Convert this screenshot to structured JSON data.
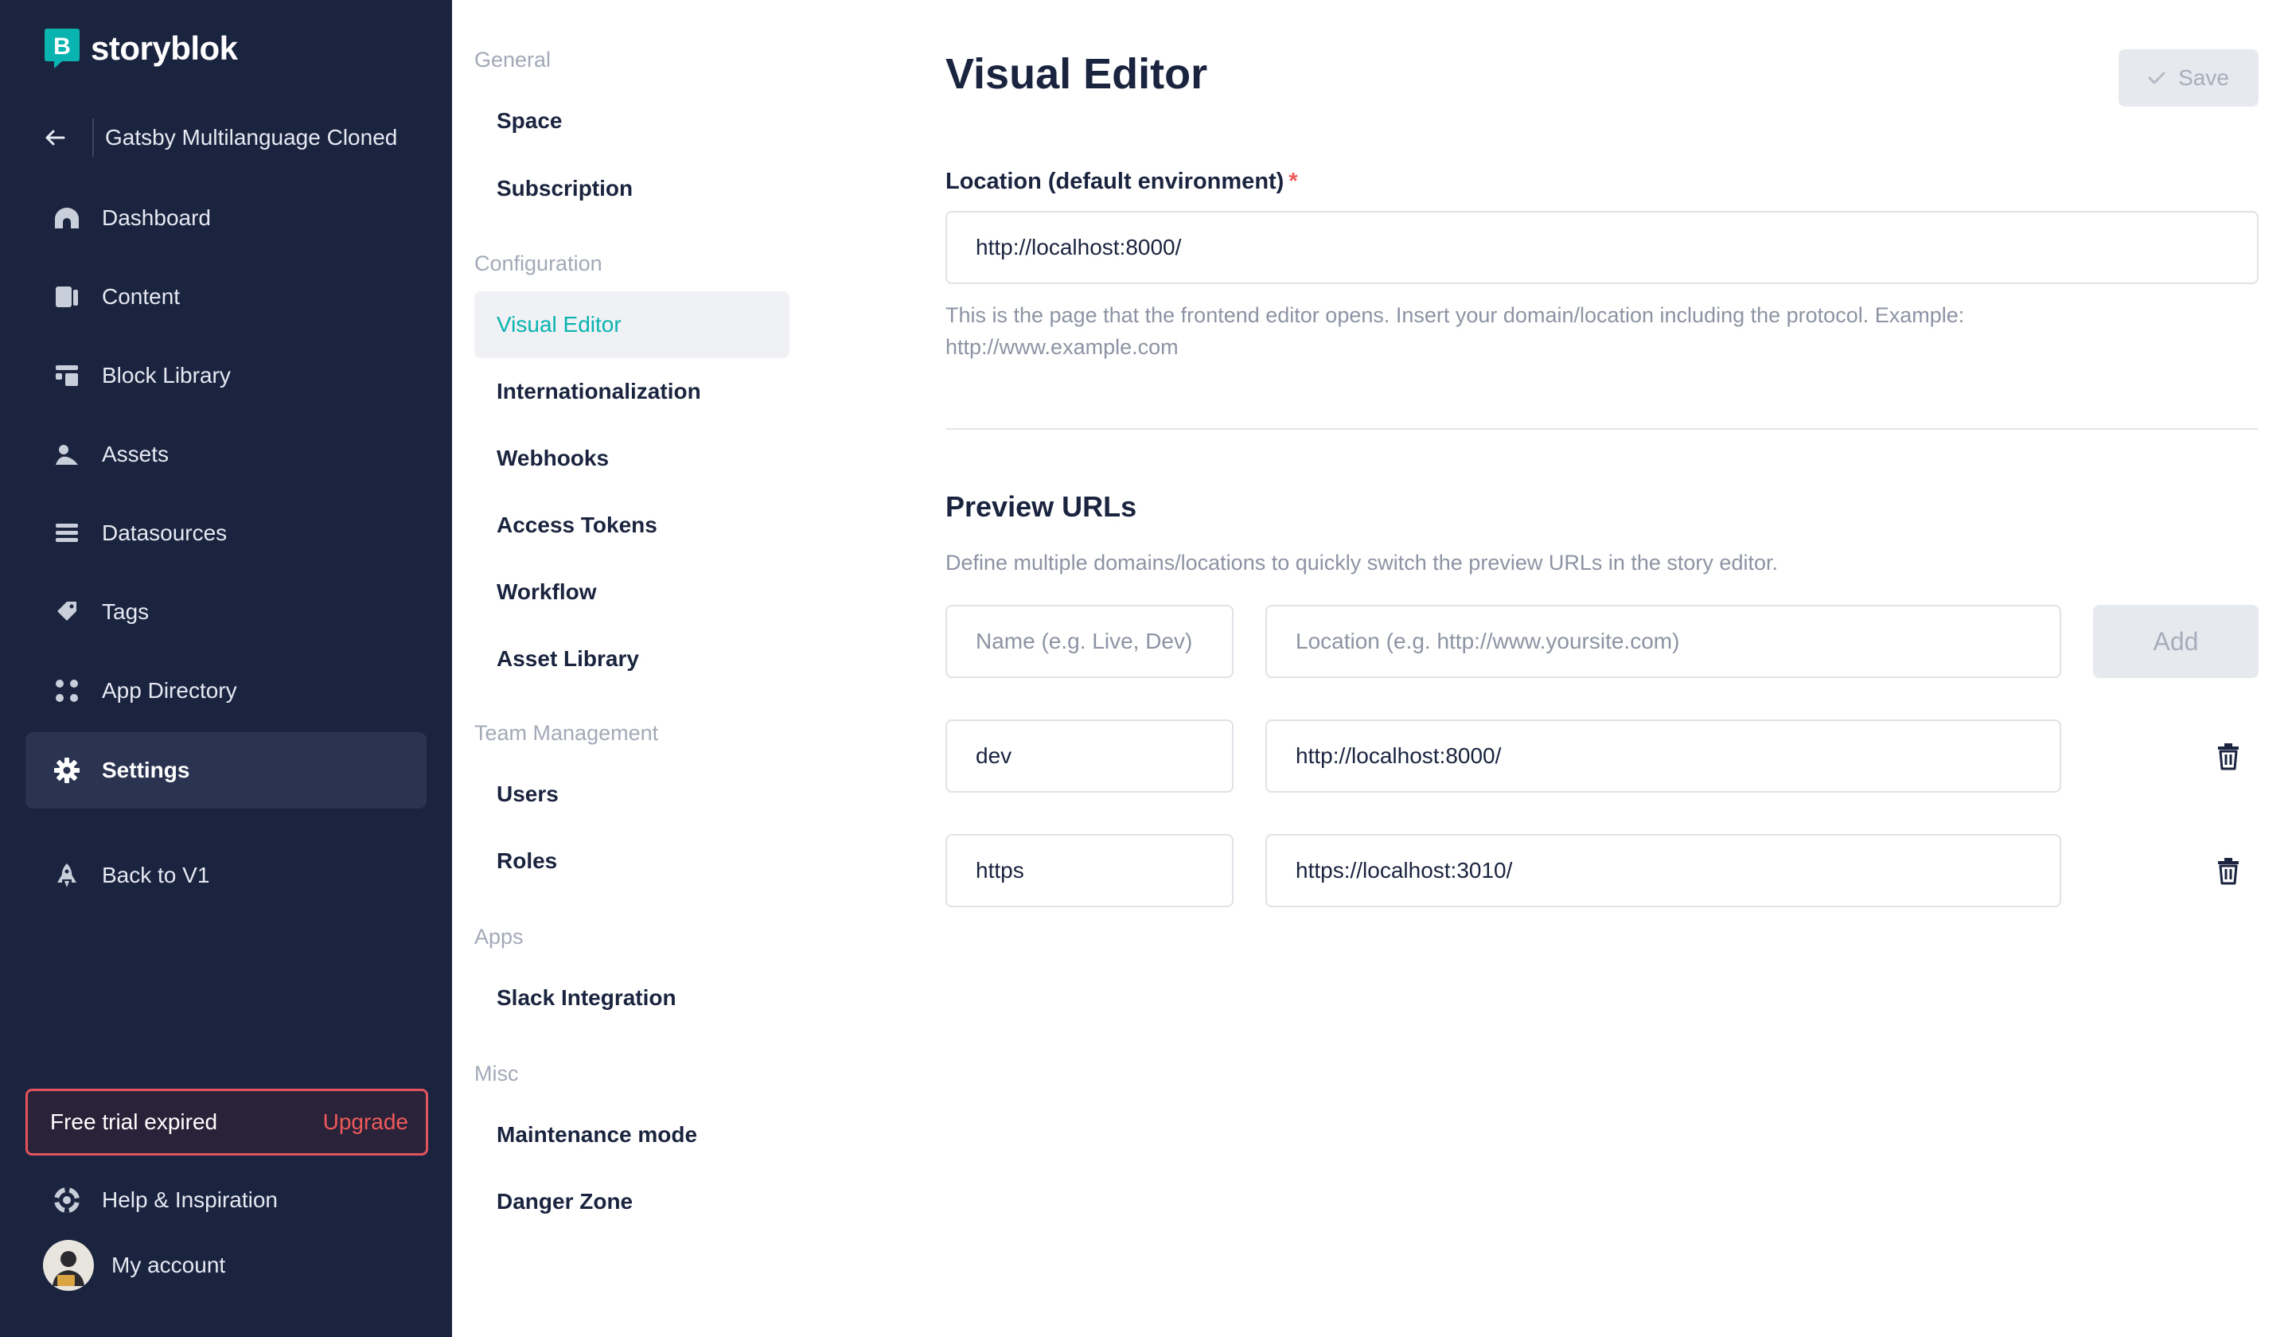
{
  "brand": {
    "name": "storyblok",
    "accent": "#09b3af",
    "logo_letter": "B"
  },
  "space": {
    "name": "Gatsby Multilanguage Cloned"
  },
  "nav": {
    "items": [
      {
        "label": "Dashboard",
        "icon": "dashboard-icon"
      },
      {
        "label": "Content",
        "icon": "content-icon"
      },
      {
        "label": "Block Library",
        "icon": "block-library-icon"
      },
      {
        "label": "Assets",
        "icon": "assets-icon"
      },
      {
        "label": "Datasources",
        "icon": "datasources-icon"
      },
      {
        "label": "Tags",
        "icon": "tags-icon"
      },
      {
        "label": "App Directory",
        "icon": "app-directory-icon"
      },
      {
        "label": "Settings",
        "icon": "gear-icon",
        "active": true
      }
    ],
    "back_v1": "Back to V1",
    "help": "Help & Inspiration",
    "account": "My account"
  },
  "trial": {
    "text": "Free trial expired",
    "upgrade": "Upgrade",
    "border_color": "#e2545d"
  },
  "settings_menu": {
    "general": {
      "title": "General",
      "items": [
        "Space",
        "Subscription"
      ]
    },
    "configuration": {
      "title": "Configuration",
      "items": [
        "Visual Editor",
        "Internationalization",
        "Webhooks",
        "Access Tokens",
        "Workflow",
        "Asset Library"
      ]
    },
    "team": {
      "title": "Team Management",
      "items": [
        "Users",
        "Roles"
      ]
    },
    "apps": {
      "title": "Apps",
      "items": [
        "Slack Integration"
      ]
    },
    "misc": {
      "title": "Misc",
      "items": [
        "Maintenance mode",
        "Danger Zone"
      ]
    }
  },
  "main": {
    "title": "Visual Editor",
    "save_label": "Save",
    "location_label": "Location (default environment)",
    "required_mark": "*",
    "location_value": "http://localhost:8000/",
    "location_help": "This is the page that the frontend editor opens. Insert your domain/location including the protocol. Example: http://www.example.com",
    "preview_title": "Preview URLs",
    "preview_desc": "Define multiple domains/locations to quickly switch the preview URLs in the story editor.",
    "name_placeholder": "Name (e.g. Live, Dev)",
    "location_placeholder": "Location (e.g. http://www.yoursite.com)",
    "add_label": "Add",
    "preview_urls": [
      {
        "name": "dev",
        "location": "http://localhost:8000/"
      },
      {
        "name": "https",
        "location": "https://localhost:3010/"
      }
    ]
  }
}
